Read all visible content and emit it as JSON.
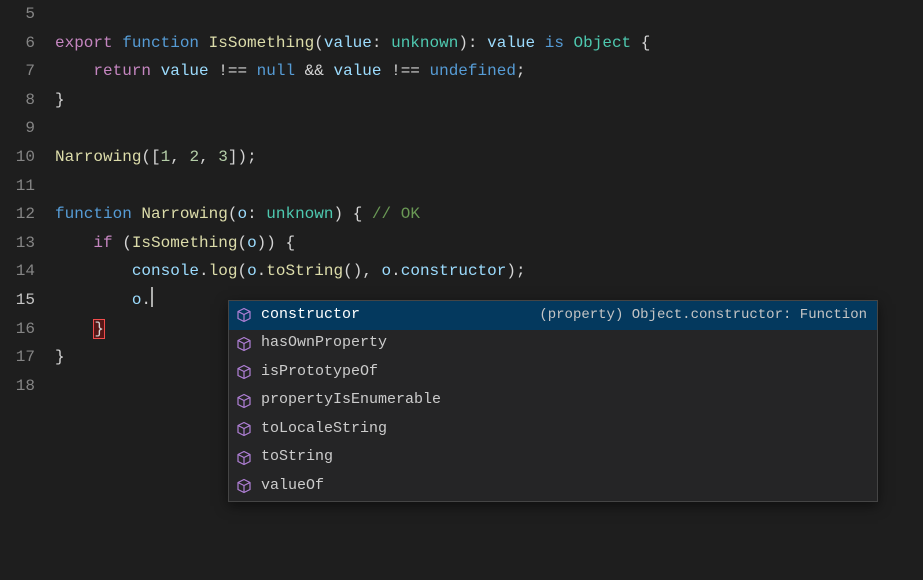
{
  "gutter": {
    "start": 5,
    "end": 18,
    "activeLine": 15
  },
  "code": {
    "l6": {
      "export": "export",
      "function": "function",
      "fnName": "IsSomething",
      "lp": "(",
      "param": "value",
      "colon": ": ",
      "type": "unknown",
      "rp": ")",
      "space": " ",
      "colon2": ": ",
      "param2": "value",
      "is": " is ",
      "type2": "Object",
      "ob": " {"
    },
    "l7": {
      "indent": "    ",
      "return": "return",
      "sp": " ",
      "v1": "value",
      "op1": " !== ",
      "null": "null",
      "and": " && ",
      "v2": "value",
      "op2": " !== ",
      "undef": "undefined",
      "semi": ";"
    },
    "l8": {
      "cb": "}"
    },
    "l10": {
      "fn": "Narrowing",
      "lp": "(",
      "lb": "[",
      "n1": "1",
      "c1": ", ",
      "n2": "2",
      "c2": ", ",
      "n3": "3",
      "rb": "]",
      "rp": ")",
      "semi": ";"
    },
    "l12": {
      "function": "function",
      "sp": " ",
      "fn": "Narrowing",
      "lp": "(",
      "param": "o",
      "colon": ": ",
      "type": "unknown",
      "rp": ")",
      "ob": " { ",
      "comment": "// OK"
    },
    "l13": {
      "indent": "    ",
      "if": "if",
      "sp": " ",
      "lp": "(",
      "fn": "IsSomething",
      "lp2": "(",
      "arg": "o",
      "rp2": ")",
      "rp": ")",
      "ob": " {"
    },
    "l14": {
      "indent": "        ",
      "obj": "console",
      "dot": ".",
      "method": "log",
      "lp": "(",
      "o1": "o",
      "dot2": ".",
      "m2": "toString",
      "lp2": "(",
      "rp2": ")",
      "comma": ", ",
      "o2": "o",
      "dot3": ".",
      "prop": "constructor",
      "rp": ")",
      "semi": ";"
    },
    "l15": {
      "indent": "        ",
      "obj": "o",
      "dot": "."
    },
    "l16": {
      "indent": "    ",
      "cb": "}"
    },
    "l17": {
      "cb": "}"
    }
  },
  "suggest": {
    "items": [
      {
        "label": "constructor",
        "selected": true,
        "detail": "(property) Object.constructor: Function"
      },
      {
        "label": "hasOwnProperty"
      },
      {
        "label": "isPrototypeOf"
      },
      {
        "label": "propertyIsEnumerable"
      },
      {
        "label": "toLocaleString"
      },
      {
        "label": "toString"
      },
      {
        "label": "valueOf"
      }
    ]
  }
}
